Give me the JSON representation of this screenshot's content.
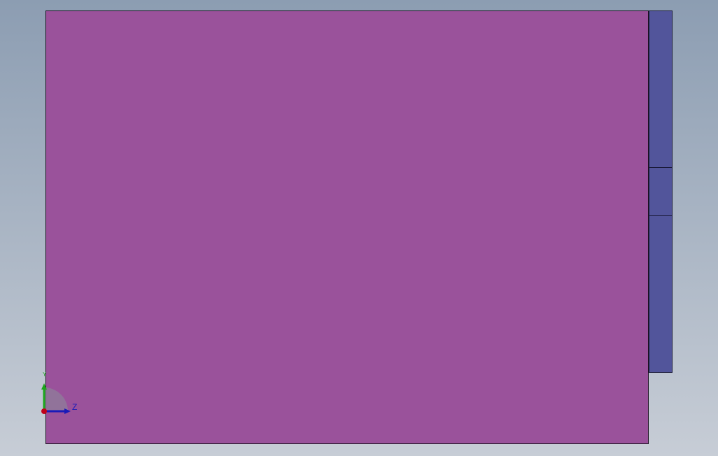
{
  "viewport": {
    "background_top": "#8c9db2",
    "background_bottom": "#c7cdd6"
  },
  "model": {
    "main_face_color": "#9a529b",
    "side_face_color": "#52559b"
  },
  "triad": {
    "z_label": "Z",
    "y_label": "Y",
    "x_color": "#c0001a",
    "y_color": "#1ca51c",
    "z_color": "#1a1ab8"
  }
}
